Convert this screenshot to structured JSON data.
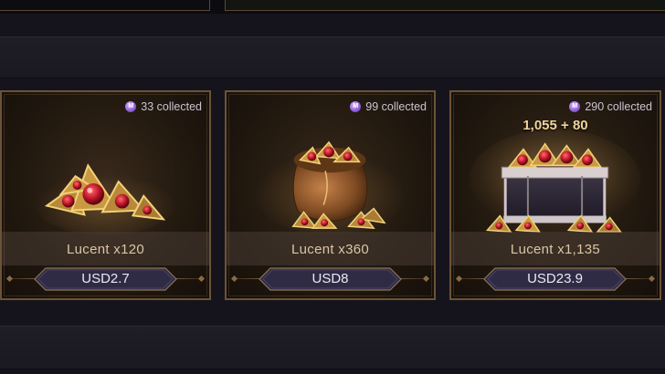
{
  "colors": {
    "page_bg": "#15141c",
    "card_border": "#6c5236",
    "gold_text": "#d9c6a3",
    "bonus_text": "#f0d49a",
    "button_fill": "#2f2b45",
    "collected_icon": "#8f5ed8"
  },
  "offers": [
    {
      "collected": "33 collected",
      "bonus": "",
      "name": "Lucent x120",
      "price": "USD2.7",
      "art": "lucent-gems-pile"
    },
    {
      "collected": "99 collected",
      "bonus": "",
      "name": "Lucent x360",
      "price": "USD8",
      "art": "lucent-pouch"
    },
    {
      "collected": "290 collected",
      "bonus": "1,055 + 80",
      "name": "Lucent x1,135",
      "price": "USD23.9",
      "art": "lucent-treasure-chest"
    }
  ]
}
